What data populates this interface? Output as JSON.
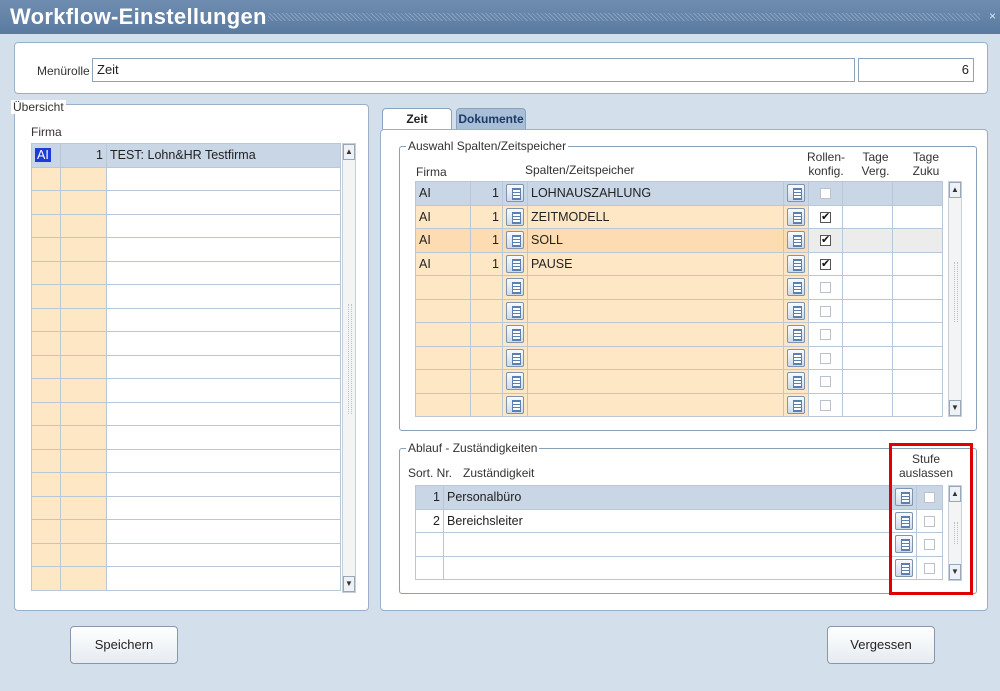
{
  "window": {
    "title": "Workflow-Einstellungen",
    "close_symbol": "×"
  },
  "menu": {
    "label": "Menürolle",
    "value": "Zeit",
    "count": "6"
  },
  "overview": {
    "legend": "Übersicht",
    "col_firma": "Firma",
    "rows": [
      {
        "code": "AI",
        "nr": "1",
        "name": "TEST: Lohn&HR Testfirma"
      }
    ]
  },
  "tabs": [
    {
      "label": "Zeit"
    },
    {
      "label": "Dokumente"
    }
  ],
  "columns_panel": {
    "legend": "Auswahl Spalten/Zeitspeicher",
    "headers": {
      "firma": "Firma",
      "spalten": "Spalten/Zeitspeicher",
      "rollen": "Rollen-\nkonfig.",
      "tage_verg": "Tage\nVerg.",
      "tage_zuku": "Tage\nZuku"
    },
    "rows": [
      {
        "code": "AI",
        "nr": "1",
        "name": "LOHNAUSZAHLUNG",
        "checked": false
      },
      {
        "code": "AI",
        "nr": "1",
        "name": "ZEITMODELL",
        "checked": true
      },
      {
        "code": "AI",
        "nr": "1",
        "name": "SOLL",
        "checked": true
      },
      {
        "code": "AI",
        "nr": "1",
        "name": "PAUSE",
        "checked": true
      }
    ]
  },
  "flow_panel": {
    "legend": "Ablauf - Zuständigkeiten",
    "headers": {
      "sort": "Sort. Nr.",
      "zust": "Zuständigkeit",
      "stufe": "Stufe\nauslassen"
    },
    "rows": [
      {
        "nr": "1",
        "name": "Personalbüro"
      },
      {
        "nr": "2",
        "name": "Bereichsleiter"
      }
    ]
  },
  "buttons": {
    "save": "Speichern",
    "forget": "Vergessen"
  },
  "colors": {
    "titlebar": "#5f7fa6",
    "highlight": "#e00000",
    "peach": "#fde7c4"
  }
}
